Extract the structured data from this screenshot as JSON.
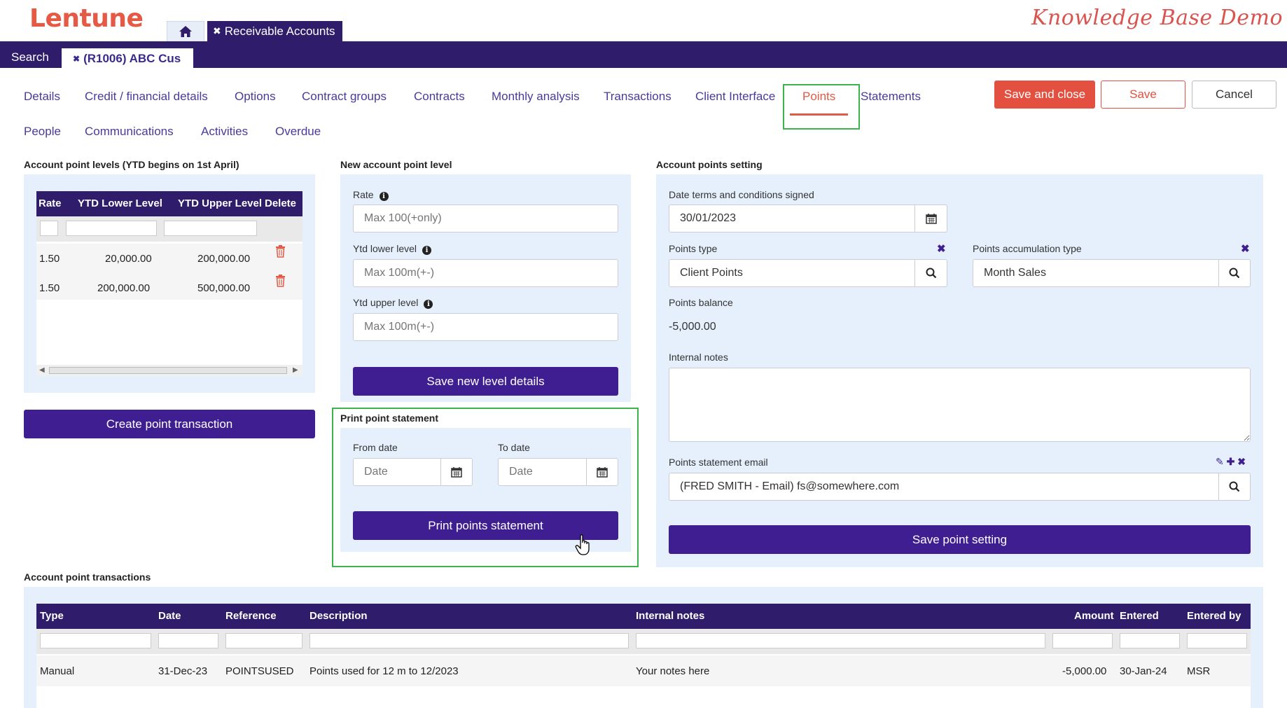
{
  "header": {
    "logo": "Lentune",
    "brand_tagline": "Knowledge Base Demo",
    "app_tab_label": "Receivable Accounts",
    "search_label": "Search",
    "record_tab_label": "(R1006) ABC Cus"
  },
  "nav": {
    "tabs": [
      "Details",
      "Credit / financial details",
      "Options",
      "Contract groups",
      "Contracts",
      "Monthly analysis",
      "Transactions",
      "Client Interface",
      "Points",
      "Statements"
    ],
    "tabs_row2": [
      "People",
      "Communications",
      "Activities",
      "Overdue"
    ],
    "active_tab": "Points"
  },
  "actions": {
    "save_and_close": "Save and close",
    "save": "Save",
    "cancel": "Cancel"
  },
  "point_levels": {
    "title": "Account point levels (YTD begins on 1st April)",
    "columns": [
      "Rate",
      "YTD Lower Level",
      "YTD Upper Level",
      "Delete"
    ],
    "rows": [
      {
        "rate": "1.50",
        "lower": "20,000.00",
        "upper": "200,000.00"
      },
      {
        "rate": "1.50",
        "lower": "200,000.00",
        "upper": "500,000.00"
      }
    ],
    "create_button": "Create point transaction"
  },
  "new_level": {
    "title": "New account point level",
    "rate_label": "Rate",
    "rate_placeholder": "Max 100(+only)",
    "lower_label": "Ytd lower level",
    "lower_placeholder": "Max 100m(+-)",
    "upper_label": "Ytd upper level",
    "upper_placeholder": "Max 100m(+-)",
    "save_button": "Save new level details"
  },
  "print_statement": {
    "title": "Print point statement",
    "from_label": "From date",
    "to_label": "To date",
    "date_placeholder": "Date",
    "print_button": "Print points statement"
  },
  "settings": {
    "title": "Account points setting",
    "date_signed_label": "Date terms and conditions signed",
    "date_signed_value": "30/01/2023",
    "points_type_label": "Points type",
    "points_type_value": "Client Points",
    "accum_type_label": "Points accumulation type",
    "accum_type_value": "Month Sales",
    "balance_label": "Points balance",
    "balance_value": "-5,000.00",
    "notes_label": "Internal notes",
    "notes_value": "",
    "email_label": "Points statement email",
    "email_value": "(FRED SMITH - Email) fs@somewhere.com",
    "save_button": "Save point setting"
  },
  "transactions": {
    "title": "Account point transactions",
    "columns": [
      "Type",
      "Date",
      "Reference",
      "Description",
      "Internal notes",
      "Amount",
      "Entered",
      "Entered by"
    ],
    "rows": [
      {
        "type": "Manual",
        "date": "31-Dec-23",
        "reference": "POINTSUSED",
        "description": "Points used for 12 m to 12/2023",
        "notes": "Your notes here",
        "amount": "-5,000.00",
        "entered": "30-Jan-24",
        "entered_by": "MSR"
      }
    ]
  },
  "colors": {
    "brand_purple": "#2f1c6a",
    "button_purple": "#3f1e91",
    "accent_red": "#e3503f",
    "highlight_green": "#3cb44b",
    "panel_blue": "#e6f0fc"
  }
}
